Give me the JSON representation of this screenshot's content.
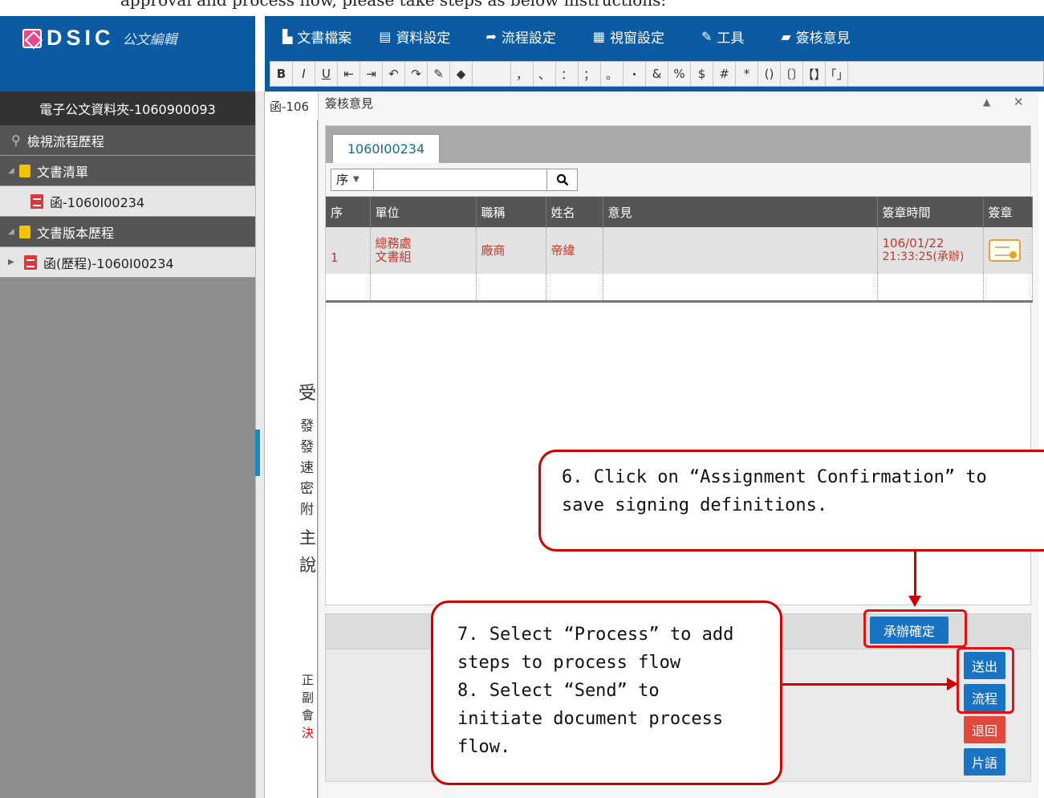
{
  "top_strip_text": "approval and process flow, please take steps as below instructions:",
  "logo": {
    "text": "DSIC",
    "subtitle": "公文編輯"
  },
  "menu": [
    {
      "label": "文書檔案",
      "icon": "document-icon",
      "glyph": "▙"
    },
    {
      "label": "資料設定",
      "icon": "form-icon",
      "glyph": "▤"
    },
    {
      "label": "流程設定",
      "icon": "share-arrow-icon",
      "glyph": "➦"
    },
    {
      "label": "視窗設定",
      "icon": "grid-icon",
      "glyph": "▦"
    },
    {
      "label": "工具",
      "icon": "wrench-icon",
      "glyph": "🔧"
    },
    {
      "label": "簽核意見",
      "icon": "comment-icon",
      "glyph": "▰"
    }
  ],
  "toolbar": [
    "B",
    "I",
    "U",
    "⇤",
    "⇥",
    "↶",
    "↷",
    "✎",
    "◆",
    "",
    "，",
    "、",
    "：",
    "；",
    "。",
    "・",
    "&",
    "%",
    "$",
    "#",
    "*",
    "()",
    "〔〕",
    "【】",
    "「」"
  ],
  "sidebar": {
    "folder_title": "電子公文資料夾-1060900093",
    "history": "檢視流程歷程",
    "doc_list": "文書清單",
    "doc_item": "函-1060I00234",
    "version_history": "文書版本歷程",
    "version_item": "函(歷程)-1060I00234"
  },
  "doc": {
    "tab_label": "函-106",
    "chars_top": [
      "受",
      "發",
      "發",
      "速",
      "密",
      "附",
      "主",
      "說"
    ],
    "chars_bottom": [
      "正",
      "副",
      "會"
    ],
    "char_red": "決"
  },
  "dialog": {
    "title": "簽核意見",
    "minimize": "▲",
    "close": "✕",
    "tab": "1060I00234",
    "sort_label": "序",
    "search_icon": "search-icon",
    "columns": [
      "序",
      "單位",
      "職稱",
      "姓名",
      "意見",
      "簽章時間",
      "簽章"
    ],
    "rows": [
      {
        "seq": "1",
        "unit_line1": "總務處",
        "unit_line2": "文書組",
        "title": "廠商",
        "name": "帝緯",
        "opinion": "",
        "time_line1": "106/01/22",
        "time_line2": "21:33:25(承辦)"
      }
    ]
  },
  "buttons": {
    "confirm": "承辦確定",
    "send": "送出",
    "process": "流程",
    "return": "退回",
    "phrase": "片語"
  },
  "annotations": {
    "step6_line1": "6. Click on “Assignment Confirmation” to",
    "step6_line2": "save signing definitions.",
    "step78_line1": "7. Select “Process” to add",
    "step78_line2": "steps to process flow",
    "step78_line3": "8. Select “Send”  to",
    "step78_line4": "initiate document process",
    "step78_line5": "flow."
  },
  "colors": {
    "brand": "#0b5aa2",
    "accent_red": "#c00",
    "button_blue": "#1a73c2",
    "button_red": "#e04a3c"
  }
}
